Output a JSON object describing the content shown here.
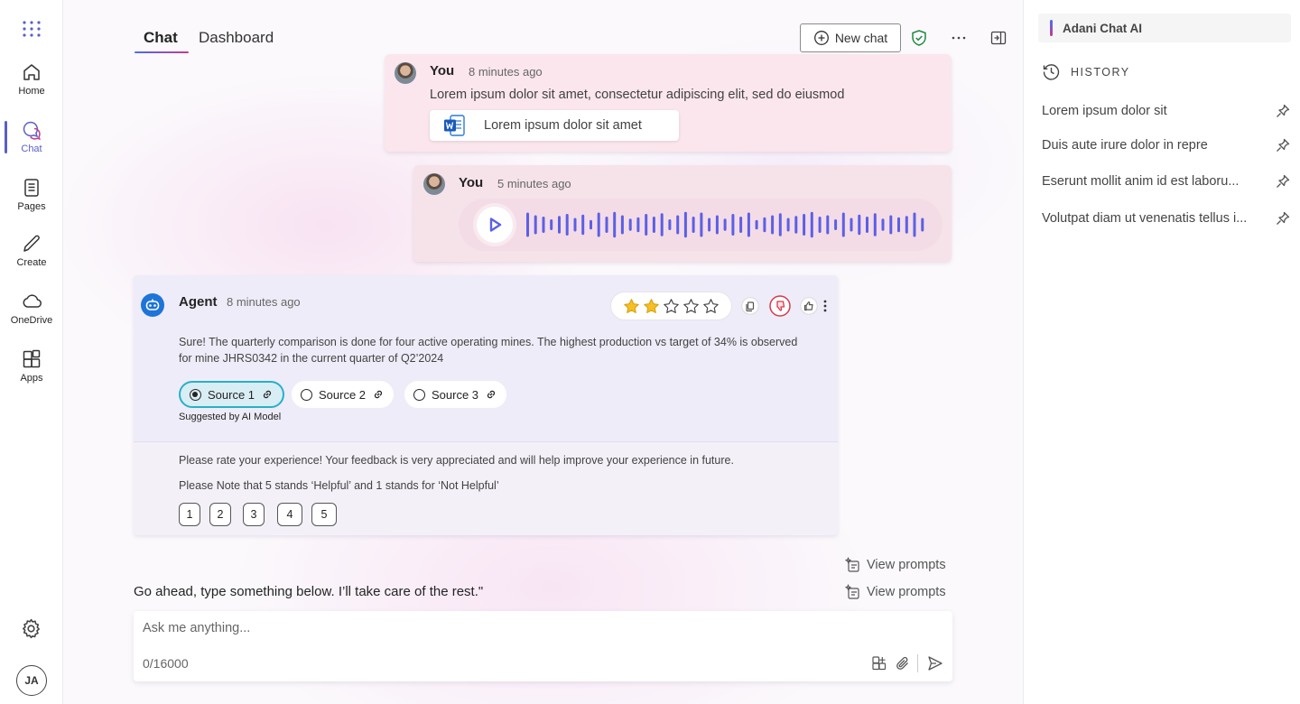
{
  "rail": {
    "items": [
      {
        "label": "Home",
        "icon": "home-icon"
      },
      {
        "label": "Chat",
        "icon": "chat-icon"
      },
      {
        "label": "Pages",
        "icon": "pages-icon"
      },
      {
        "label": "Create",
        "icon": "pen-icon"
      },
      {
        "label": "OneDrive",
        "icon": "cloud-icon"
      },
      {
        "label": "Apps",
        "icon": "apps-icon"
      }
    ],
    "avatar_initials": "JA"
  },
  "header": {
    "tabs": [
      "Chat",
      "Dashboard"
    ],
    "new_chat_label": "New chat"
  },
  "messages": {
    "first": {
      "author": "You",
      "time": "8 minutes ago",
      "text": "Lorem ipsum dolor sit amet, consectetur adipiscing elit, sed do eiusmod",
      "attachment": "Lorem ipsum dolor sit amet"
    },
    "second": {
      "author": "You",
      "time": "5 minutes ago"
    }
  },
  "agent": {
    "name": "Agent",
    "time": "8 minutes ago",
    "rating_stars": 2,
    "text": "Sure! The quarterly comparison is done for four active operating mines. The highest production vs target of 34% is observed for mine JHRS0342 in the current quarter of Q2’2024",
    "sources": [
      "Source 1",
      "Source 2",
      "Source 3"
    ],
    "suggested": "Suggested by AI Model",
    "feedback_line1": "Please rate your experience! Your feedback is very appreciated and will help improve your experience in future.",
    "feedback_line2": "Please Note that 5 stands ‘Helpful’ and 1 stands for ‘Not Helpful’",
    "ratings": [
      "1",
      "2",
      "3",
      "4",
      "5"
    ]
  },
  "prompts": {
    "view_prompts_1": "View prompts",
    "view_prompts_2": "View prompts",
    "go_ahead": "Go ahead, type something below. I’ll take care of the rest.\""
  },
  "composer": {
    "placeholder": "Ask me anything...",
    "counter": "0/16000"
  },
  "panel": {
    "title": "Adani Chat AI",
    "history_heading": "HISTORY",
    "history": [
      "Lorem ipsum dolor sit",
      "Duis aute irure dolor in repre",
      "Eserunt mollit anim id est laboru...",
      "Volutpat diam ut venenatis tellus i..."
    ]
  },
  "colors": {
    "accent": "#5b5fc7",
    "source_selected_border": "#27b1c7",
    "wave": "#5b5fe8",
    "star_fill": "#f5c024"
  }
}
